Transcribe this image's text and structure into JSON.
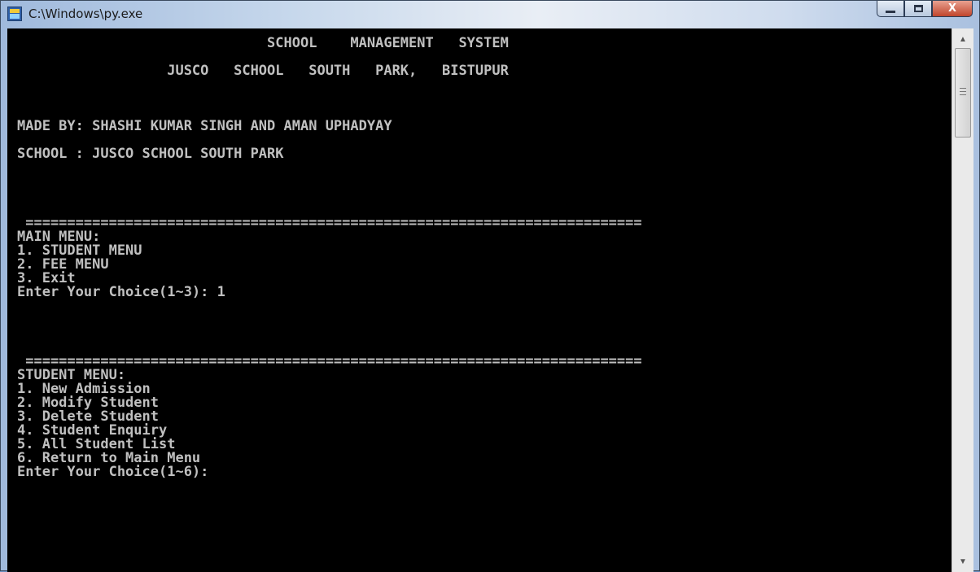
{
  "window": {
    "title": "C:\\Windows\\py.exe"
  },
  "console": {
    "lines": [
      "                              SCHOOL    MANAGEMENT   SYSTEM",
      "",
      "                  JUSCO   SCHOOL   SOUTH   PARK,   BISTUPUR",
      "",
      "",
      "",
      "MADE BY: SHASHI KUMAR SINGH AND AMAN UPHADYAY",
      "",
      "SCHOOL : JUSCO SCHOOL SOUTH PARK",
      "",
      "",
      "",
      "",
      " ==========================================================================",
      "MAIN MENU:",
      "1. STUDENT MENU",
      "2. FEE MENU",
      "3. Exit",
      "Enter Your Choice(1~3): 1",
      "",
      "",
      "",
      "",
      " ==========================================================================",
      "STUDENT MENU:",
      "1. New Admission",
      "2. Modify Student",
      "3. Delete Student",
      "4. Student Enquiry",
      "5. All Student List",
      "6. Return to Main Menu",
      "Enter Your Choice(1~6):"
    ]
  },
  "icons": {
    "app": "console-app-icon",
    "minimize": "minimize-icon",
    "maximize": "maximize-icon",
    "close": "close-icon",
    "scroll_up": "scroll-up-arrow-icon",
    "scroll_down": "scroll-down-arrow-icon"
  },
  "glyphs": {
    "close": "X",
    "scroll_up": "▲",
    "scroll_down": "▼"
  }
}
